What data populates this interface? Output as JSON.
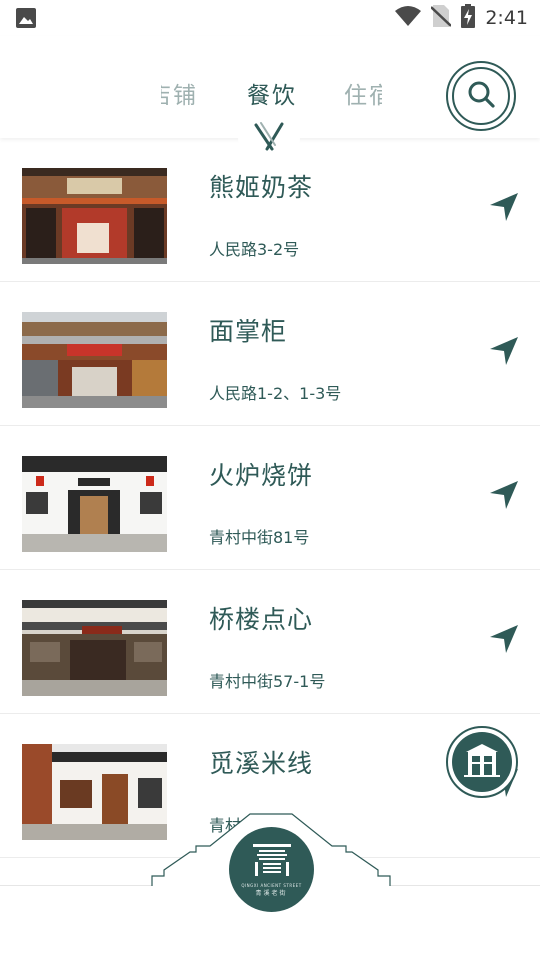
{
  "status_bar": {
    "time": "2:41",
    "icons": [
      "image-icon",
      "wifi-icon",
      "no-sim-icon",
      "battery-charging-icon"
    ]
  },
  "tabs": {
    "items": [
      {
        "label": "店铺",
        "selected": false
      },
      {
        "label": "餐饮",
        "selected": true
      },
      {
        "label": "住宿",
        "selected": false
      }
    ],
    "indicator_icon": "chopsticks-icon",
    "search_icon": "search-icon"
  },
  "restaurants": [
    {
      "name": "熊姬奶茶",
      "address": "人民路3-2号"
    },
    {
      "name": "面掌柜",
      "address": "人民路1-2、1-3号"
    },
    {
      "name": "火炉烧饼",
      "address": "青村中街81号"
    },
    {
      "name": "桥楼点心",
      "address": "青村中街57-1号"
    },
    {
      "name": "觅溪米线",
      "address": "青村中街"
    }
  ],
  "floating_button": {
    "icon": "archway-icon"
  },
  "bottom_logo": {
    "subtitle": "QINGXI ANCIENT STREET",
    "title": "青溪老街"
  },
  "colors": {
    "accent": "#2f5a57",
    "inactive_tab": "#9fb1b0",
    "divider": "#ececec"
  }
}
